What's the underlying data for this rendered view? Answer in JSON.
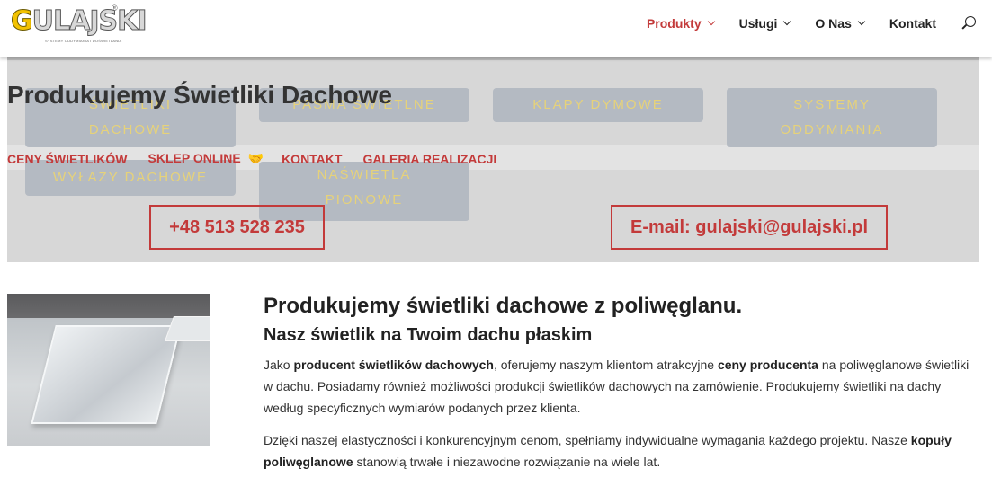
{
  "header": {
    "logo": {
      "text_pre": "G",
      "text_main": "ULAJSKI",
      "reg": "®",
      "tagline": "SYSTEMY ODDYMIANIA I DOŚWIETLANIA"
    },
    "nav": [
      {
        "label": "Produkty",
        "has_dropdown": true,
        "active": true
      },
      {
        "label": "Usługi",
        "has_dropdown": true,
        "active": false
      },
      {
        "label": "O Nas",
        "has_dropdown": true,
        "active": false
      },
      {
        "label": "Kontakt",
        "has_dropdown": false,
        "active": false
      }
    ],
    "search_icon": "search-icon"
  },
  "hero": {
    "title": "Produkujemy Świetliki Dachowe",
    "categories": [
      {
        "line1": "ŚWIETLIKI",
        "line2": "DACHOWE"
      },
      {
        "line1": "PASMA ŚWIETLNE",
        "line2": ""
      },
      {
        "line1": "KLAPY DYMOWE",
        "line2": ""
      },
      {
        "line1": "SYSTEMY",
        "line2": "ODDYMIANIA"
      },
      {
        "line1": "WYŁAZY DACHOWE",
        "line2": ""
      },
      {
        "line1": "NAŚWIETLA",
        "line2": "PIONOWE"
      }
    ],
    "links": {
      "prices": "CENY ŚWIETLIKÓW",
      "shop": "SKLEP ONLINE",
      "shop_icon": "handshake-icon",
      "contact": "KONTAKT",
      "gallery": "GALERIA REALIZACJI"
    },
    "phone": "+48 513 528 235",
    "email": "E-mail: gulajski@gulajski.pl"
  },
  "content": {
    "title": "Produkujemy świetliki dachowe z poliwęglanu.",
    "subtitle": "Nasz świetlik na Twoim dachu płaskim",
    "p1": {
      "t1": "Jako ",
      "b1": "producent świetlików dachowych",
      "t2": ", oferujemy naszym klientom atrakcyjne ",
      "b2": "ceny producenta",
      "t3": " na poliwęglanowe świetliki w dachu. Posiadamy również możliwości produkcji świetlików dachowych na zamówienie. Produkujemy świetliki na dachy według specyficznych wymiarów podanych przez klienta."
    },
    "p2": {
      "t1": "Dzięki naszej elastyczności i konkurencyjnym cenom, spełniamy indywidualne wymagania każdego projektu. Nasze ",
      "b1": "kopuły poliwęglanowe",
      "t2": " stanowią trwałe i niezawodne rozwiązanie na wiele lat."
    }
  },
  "colors": {
    "accent": "#c33a3a",
    "category_text": "#e6d27a",
    "category_bg": "#b4bac2",
    "hero_bg": "#d7d7d7"
  }
}
